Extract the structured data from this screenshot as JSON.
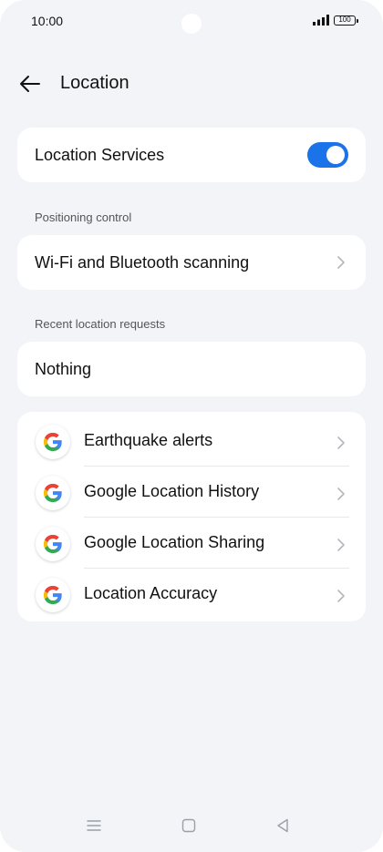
{
  "status_bar": {
    "time": "10:00",
    "battery": "100"
  },
  "header": {
    "title": "Location"
  },
  "location_services": {
    "label": "Location Services",
    "enabled": true
  },
  "positioning_control": {
    "section_label": "Positioning control",
    "item_label": "Wi-Fi and Bluetooth scanning"
  },
  "recent_requests": {
    "section_label": "Recent location requests",
    "value": "Nothing"
  },
  "services": [
    {
      "label": "Earthquake alerts",
      "icon": "google-g-icon"
    },
    {
      "label": "Google Location History",
      "icon": "google-g-icon"
    },
    {
      "label": "Google Location Sharing",
      "icon": "google-g-icon"
    },
    {
      "label": "Location Accuracy",
      "icon": "google-g-icon"
    }
  ],
  "colors": {
    "accent": "#1a73e8",
    "background": "#f2f4f7",
    "card": "#ffffff"
  }
}
